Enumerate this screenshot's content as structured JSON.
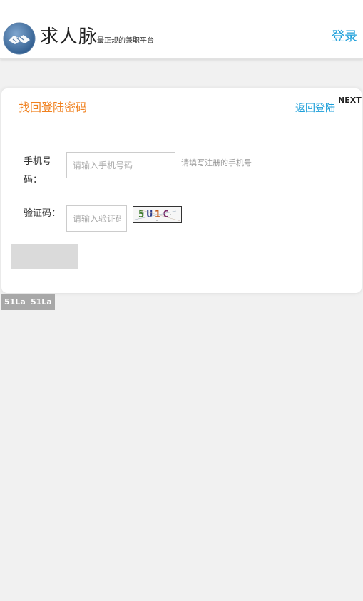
{
  "header": {
    "brand_name": "求人脉",
    "tagline": "最正规的兼职平台",
    "login_label": "登录"
  },
  "card": {
    "title": "找回登陆密码",
    "back_label": "返回登陆",
    "next_label": "NEXT"
  },
  "form": {
    "phone_label": "手机号码：",
    "phone_placeholder": "请输入手机号码",
    "phone_value": "",
    "phone_hint": "请填写注册的手机号",
    "code_label": "验证码：",
    "code_placeholder": "请输入验证码",
    "code_value": "",
    "captcha_chars": [
      "5",
      "U",
      "1",
      "C"
    ],
    "submit_label": ""
  },
  "badges": [
    "51La",
    "51La"
  ],
  "colors": {
    "accent_orange": "#f0811f",
    "link_blue": "#1a9ed9",
    "button_gray": "#dadada",
    "page_background": "#f1f1f1"
  },
  "icons": {
    "logo": "handshake-globe-logo"
  }
}
